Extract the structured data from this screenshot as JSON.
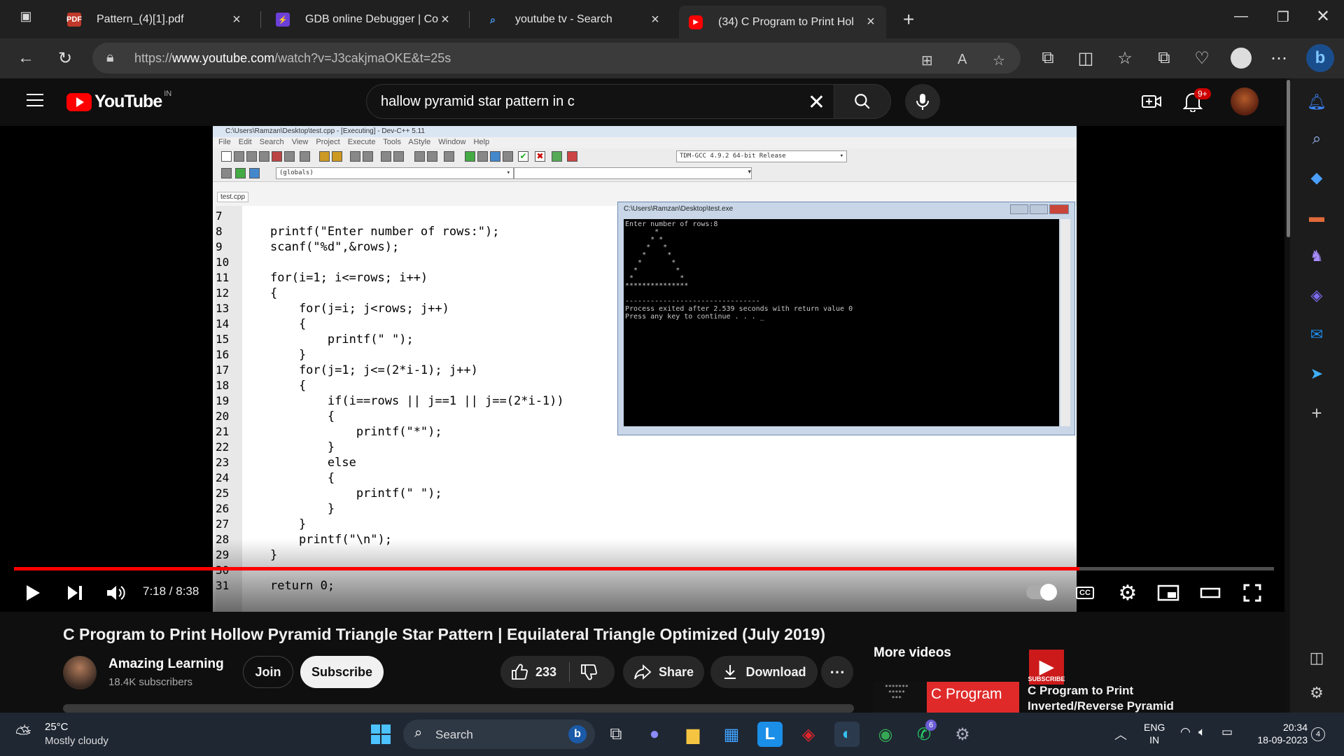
{
  "browser": {
    "tabs": [
      {
        "label": "Pattern_(4)[1].pdf",
        "icon": "pdf-icon"
      },
      {
        "label": "GDB online Debugger | Cor",
        "icon": "bolt-icon"
      },
      {
        "label": "youtube tv - Search",
        "icon": "search-icon"
      },
      {
        "label": "(34) C Program to Print Hol",
        "icon": "youtube-icon"
      }
    ],
    "url_prefix": "https://",
    "url_domain": "www.youtube.com",
    "url_path": "/watch?v=J3cakjmaOKE&t=25s"
  },
  "youtube": {
    "logo_text": "YouTube",
    "country_code": "IN",
    "search_query": "hallow pyramid star pattern in c",
    "notifications_badge": "9+"
  },
  "player": {
    "time": "7:18 / 8:38",
    "progress_fraction": 0.8456,
    "subscribe_watermark": "SUBSCRIBE",
    "cc_label": "CC"
  },
  "ide": {
    "title": "C:\\Users\\Ramzan\\Desktop\\test.cpp - [Executing] - Dev-C++ 5.11",
    "menu": "File  Edit  Search  View  Project  Execute  Tools  AStyle  Window  Help",
    "compiler": "TDM-GCC 4.9.2 64-bit Release",
    "scope": "(globals)",
    "file_tab": "test.cpp",
    "code_lines": [
      {
        "n": "7",
        "code": ""
      },
      {
        "n": "8",
        "code": "printf(\"Enter number of rows:\");"
      },
      {
        "n": "9",
        "code": "scanf(\"%d\",&rows);"
      },
      {
        "n": "10",
        "code": ""
      },
      {
        "n": "11",
        "code": "for(i=1; i<=rows; i++)"
      },
      {
        "n": "12",
        "code": "{"
      },
      {
        "n": "13",
        "code": "    for(j=i; j<rows; j++)"
      },
      {
        "n": "14",
        "code": "    {"
      },
      {
        "n": "15",
        "code": "        printf(\" \");"
      },
      {
        "n": "16",
        "code": "    }"
      },
      {
        "n": "17",
        "code": "    for(j=1; j<=(2*i-1); j++)"
      },
      {
        "n": "18",
        "code": "    {"
      },
      {
        "n": "19",
        "code": "        if(i==rows || j==1 || j==(2*i-1))"
      },
      {
        "n": "20",
        "code": "        {"
      },
      {
        "n": "21",
        "code": "            printf(\"*\");"
      },
      {
        "n": "22",
        "code": "        }"
      },
      {
        "n": "23",
        "code": "        else"
      },
      {
        "n": "24",
        "code": "        {"
      },
      {
        "n": "25",
        "code": "            printf(\" \");"
      },
      {
        "n": "26",
        "code": "        }"
      },
      {
        "n": "27",
        "code": "    }"
      },
      {
        "n": "28",
        "code": "    printf(\"\\n\");"
      },
      {
        "n": "29",
        "code": "}"
      },
      {
        "n": "30",
        "code": ""
      },
      {
        "n": "31",
        "code": "return 0;"
      }
    ],
    "console_title": "C:\\Users\\Ramzan\\Desktop\\test.exe",
    "console_output": "Enter number of rows:8\n       *\n      * *\n     *   *\n    *     *\n   *       *\n  *         *\n *           *\n***************\n\n--------------------------------\nProcess exited after 2.539 seconds with return value 0\nPress any key to continue . . . _"
  },
  "video": {
    "title": "C Program to Print Hollow Pyramid Triangle Star Pattern | Equilateral Triangle Optimized (July 2019)",
    "channel_name": "Amazing Learning",
    "subscribers": "18.4K subscribers",
    "join_label": "Join",
    "subscribe_label": "Subscribe",
    "likes": "233",
    "share_label": "Share",
    "download_label": "Download",
    "more_videos_label": "More videos",
    "related_thumb_text": "C  Program",
    "related_title": "C Program to Print Inverted/Reverse Pyramid"
  },
  "taskbar": {
    "temperature": "25°C",
    "weather": "Mostly cloudy",
    "search_label": "Search",
    "lang_line1": "ENG",
    "lang_line2": "IN",
    "time": "20:34",
    "date": "18-09-2023",
    "notification_count": "4",
    "whatsapp_badge": "6"
  },
  "colors": {
    "youtube_red": "#ff0000",
    "accent_blue": "#0078d4"
  }
}
